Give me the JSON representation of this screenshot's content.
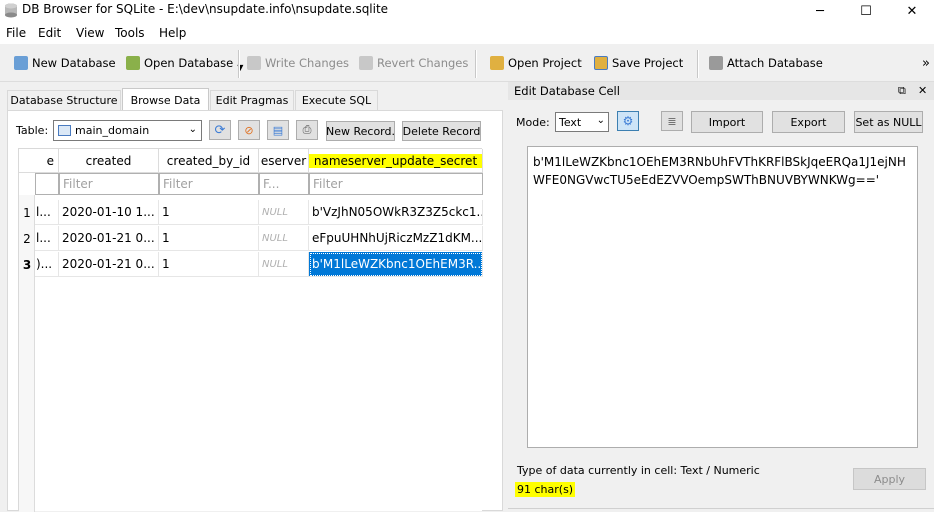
{
  "window": {
    "title": "DB Browser for SQLite - E:\\dev\\nsupdate.info\\nsupdate.sqlite",
    "minimize": "─",
    "maximize": "☐",
    "close": "✕"
  },
  "menu": [
    "File",
    "Edit",
    "View",
    "Tools",
    "Help"
  ],
  "toolbar": {
    "new_database": "New Database",
    "open_database": "Open Database",
    "write_changes": "Write Changes",
    "revert_changes": "Revert Changes",
    "open_project": "Open Project",
    "save_project": "Save Project",
    "attach_database": "Attach Database",
    "overflow": "»"
  },
  "tabs": [
    "Database Structure",
    "Browse Data",
    "Edit Pragmas",
    "Execute SQL"
  ],
  "browse": {
    "table_label": "Table:",
    "table_value": "main_domain",
    "new_record": "New Record.",
    "delete_record": "Delete Record",
    "columns": [
      "e",
      "created",
      "created_by_id",
      "eserver",
      "nameserver_update_secret"
    ],
    "filters": [
      "",
      "Filter",
      "Filter",
      "F...",
      "Filter"
    ],
    "rows": [
      {
        "num": "1",
        "c0": "l...",
        "created": "2020-01-10 1...",
        "created_by_id": "1",
        "eserver": "NULL",
        "secret": "b'VzJhN05OWkR3Z3Z5ckc1..."
      },
      {
        "num": "2",
        "c0": "l...",
        "created": "2020-01-21 0...",
        "created_by_id": "1",
        "eserver": "NULL",
        "secret": "eFpuUHNhUjRiczMzZ1dKM..."
      },
      {
        "num": "3",
        "c0": ")...",
        "created": "2020-01-21 0...",
        "created_by_id": "1",
        "eserver": "NULL",
        "secret": "b'M1lLeWZKbnc1OEhEM3R..."
      }
    ]
  },
  "cell_editor": {
    "title": "Edit Database Cell",
    "mode_label": "Mode:",
    "mode_value": "Text",
    "import": "Import",
    "export": "Export",
    "set_null": "Set as NULL",
    "content": "b'M1lLeWZKbnc1OEhEM3RNbUhFVThKRFlBSkJqeERQa1J1ejNHWFE0NGVwcTU5eEdEZVVOempSWThBNUVBYWNKWg=='",
    "type_info": "Type of data currently in cell: Text / Numeric",
    "char_count": "91 char(s)",
    "apply": "Apply",
    "pin": "⧉",
    "close": "✕"
  },
  "colors": {
    "highlight": "#ffff00",
    "selection": "#0078d7"
  }
}
